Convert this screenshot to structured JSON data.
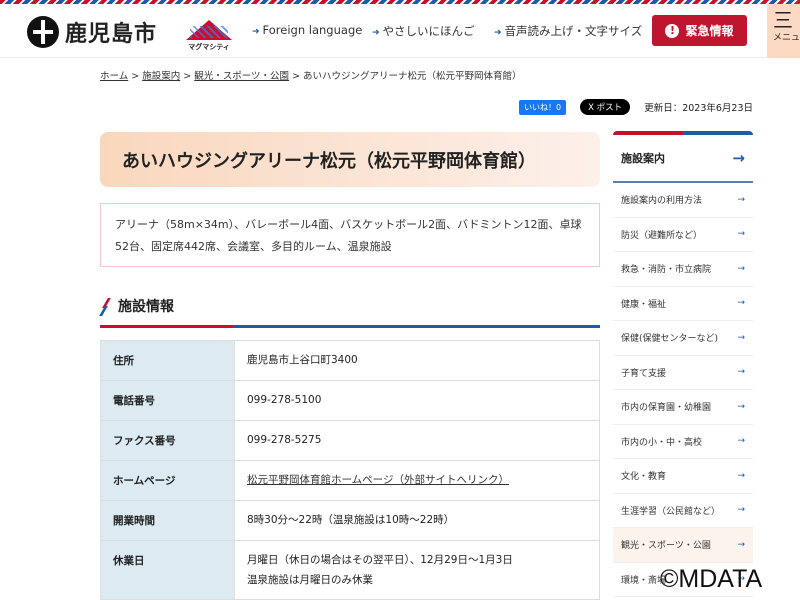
{
  "header": {
    "city_name": "鹿児島市",
    "magma_logo_text": "マグマシティ",
    "links": [
      "Foreign language",
      "やさしいにほんご",
      "音声読み上げ・文字サイズ"
    ],
    "emergency_label": "緊急情報",
    "menu_label": "メニュー"
  },
  "breadcrumb": {
    "items": [
      "ホーム",
      "施設案内",
      "観光・スポーツ・公園"
    ],
    "current": "あいハウジングアリーナ松元（松元平野岡体育館）"
  },
  "social": {
    "like_label": "いいね！0",
    "post_label": "X ポスト",
    "updated": "更新日：2023年6月23日"
  },
  "page": {
    "title": "あいハウジングアリーナ松元（松元平野岡体育館）",
    "description": "アリーナ（58m×34m）、バレーボール4面、バスケットボール2面、バドミントン12面、卓球52台、固定席442席、会議室、多目的ルーム、温泉施設",
    "section_title": "施設情報"
  },
  "facility_table": [
    {
      "label": "住所",
      "value": "鹿児島市上谷口町3400"
    },
    {
      "label": "電話番号",
      "value": "099-278-5100"
    },
    {
      "label": "ファクス番号",
      "value": "099-278-5275"
    },
    {
      "label": "ホームページ",
      "value": "松元平野岡体育館ホームページ（外部サイトへリンク）"
    },
    {
      "label": "開業時間",
      "value": "8時30分～22時（温泉施設は10時～22時）"
    },
    {
      "label": "休業日",
      "value": "月曜日（休日の場合はその翌平日）、12月29日～1月3日",
      "value2": "温泉施設は月曜日のみ休業"
    }
  ],
  "sidebar": {
    "title": "施設案内",
    "items": [
      "施設案内の利用方法",
      "防災（避難所など）",
      "救急・消防・市立病院",
      "健康・福祉",
      "保健(保健センターなど)",
      "子育て支援",
      "市内の保育園・幼稚園",
      "市内の小・中・高校",
      "文化・教育",
      "生涯学習（公民館など）",
      "観光・スポーツ・公園",
      "環境・斎場"
    ],
    "active_index": 10
  },
  "colors": {
    "brand_red": "#c0152f",
    "brand_blue": "#1e5aa8",
    "table_header_bg": "#dceaf2"
  },
  "watermark": "©MDATA"
}
